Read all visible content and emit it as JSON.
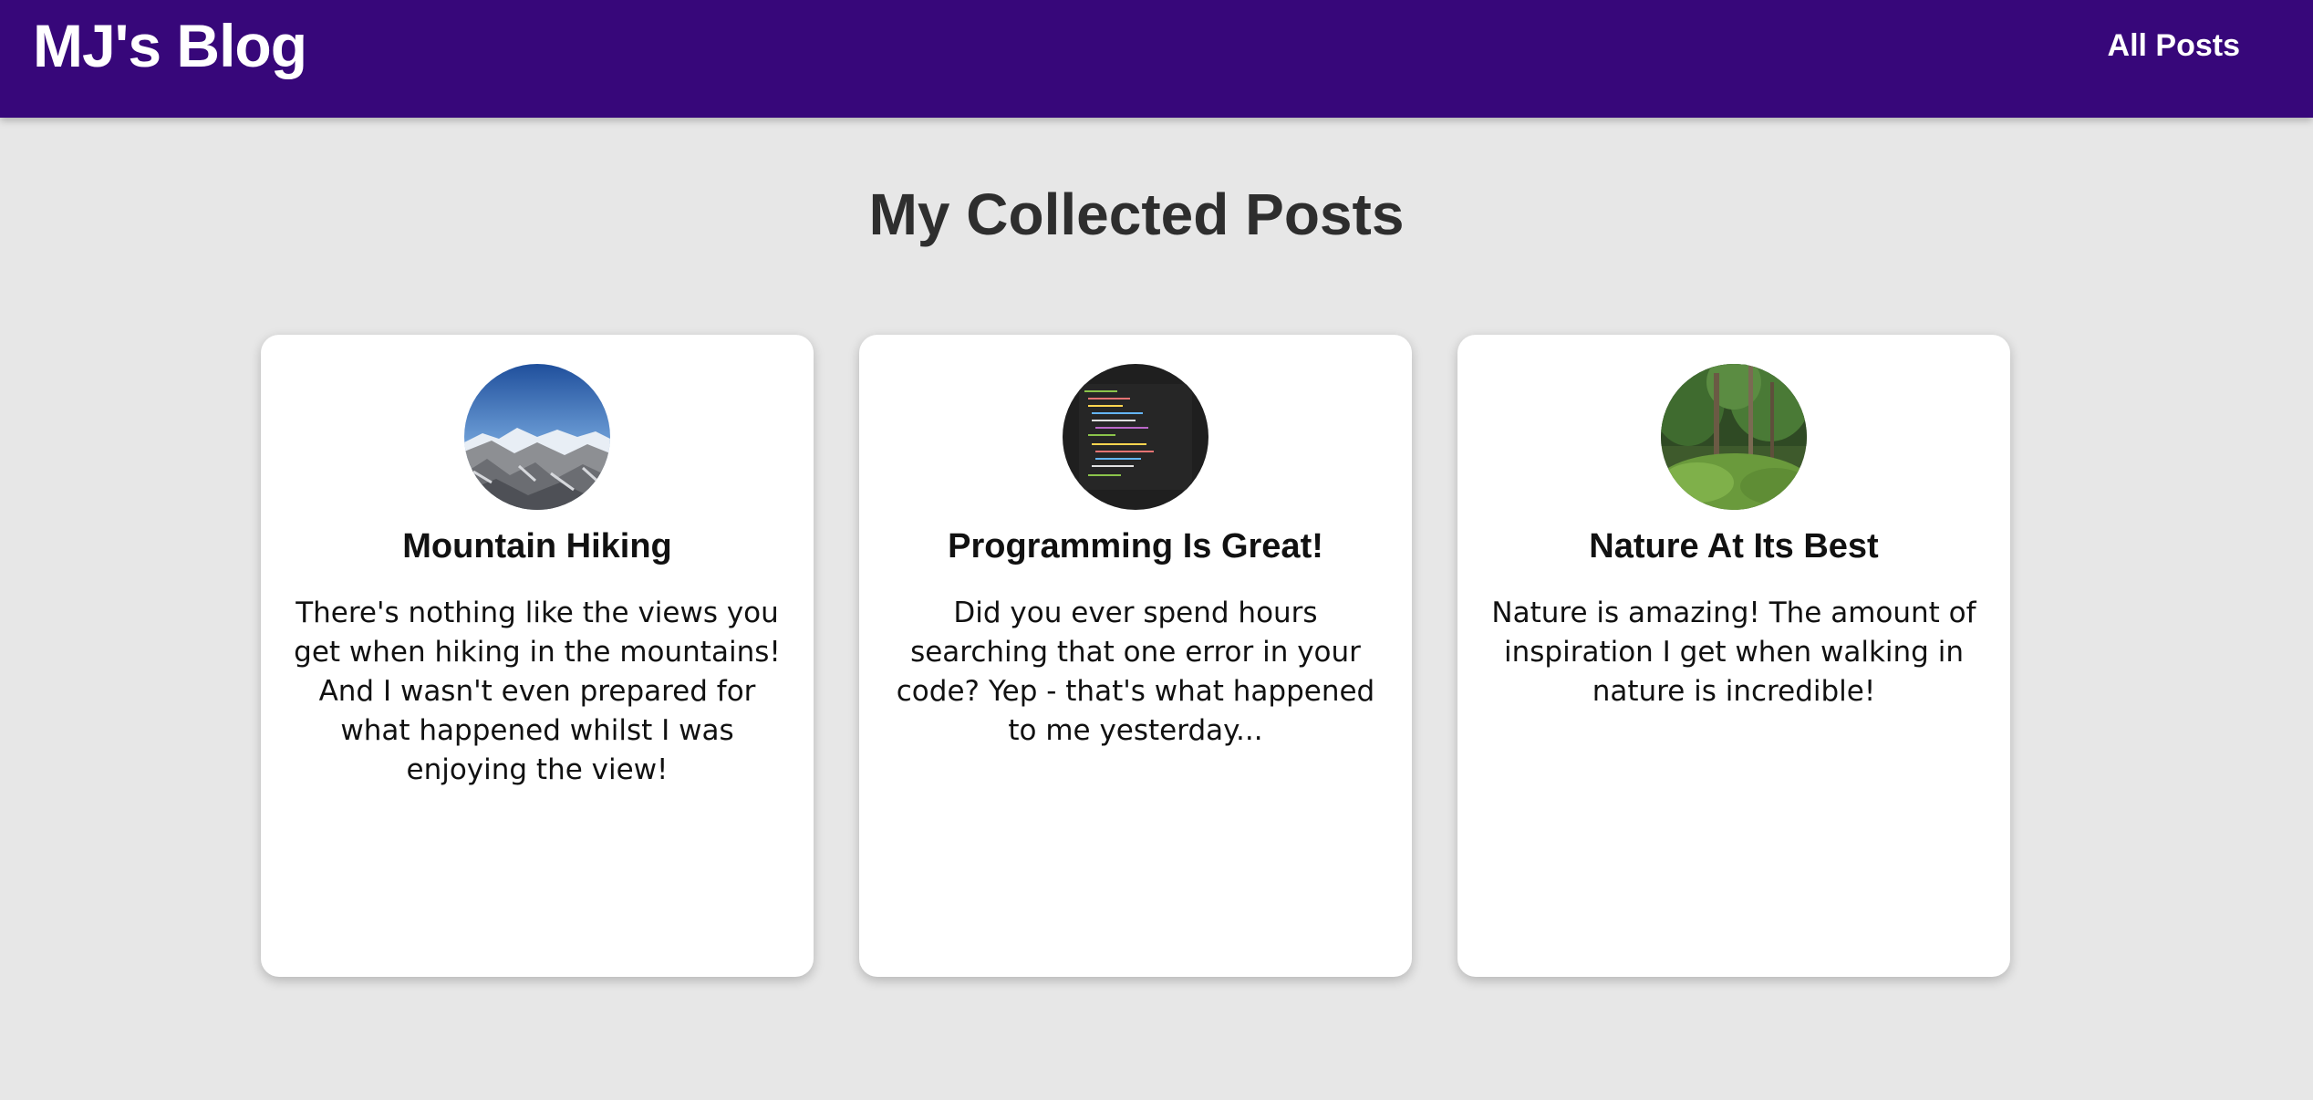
{
  "header": {
    "logo": "MJ's Blog",
    "nav": {
      "all_posts": "All Posts"
    },
    "background_color": "#37077a"
  },
  "main": {
    "title": "My Collected Posts",
    "posts": [
      {
        "title": "Mountain Hiking",
        "excerpt": "There's nothing like the views you get when hiking in the mountains! And I wasn't even prepared for what happened whilst I was enjoying the view!",
        "image_icon": "mountain-photo"
      },
      {
        "title": "Programming Is Great!",
        "excerpt": "Did you ever spend hours searching that one error in your code? Yep - that's what happened to me yesterday...",
        "image_icon": "code-screen-photo"
      },
      {
        "title": "Nature At Its Best",
        "excerpt": "Nature is amazing! The amount of inspiration I get when walking in nature is incredible!",
        "image_icon": "forest-photo"
      }
    ]
  }
}
